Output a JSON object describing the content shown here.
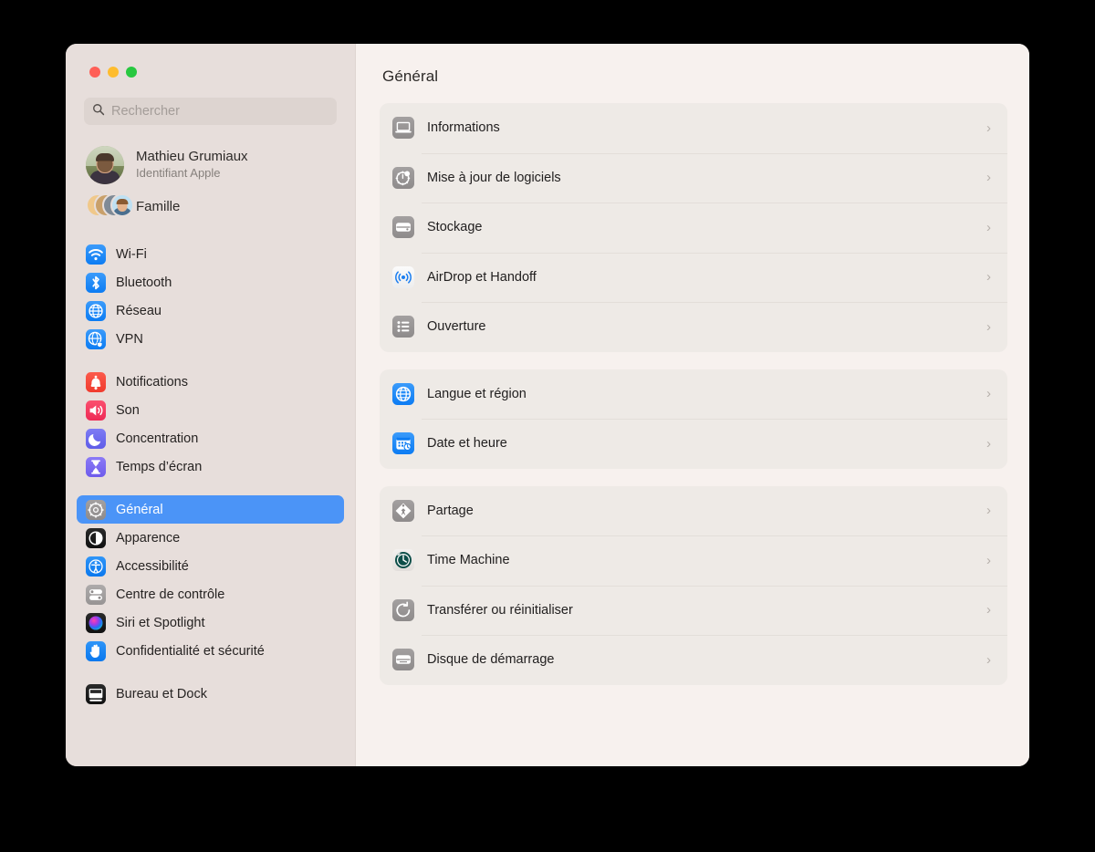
{
  "window": {
    "traffic_lights": [
      {
        "name": "close",
        "color": "#ff5f57"
      },
      {
        "name": "minimize",
        "color": "#febc2e"
      },
      {
        "name": "maximize",
        "color": "#28c840"
      }
    ]
  },
  "search": {
    "placeholder": "Rechercher",
    "value": "",
    "icon": "search-icon"
  },
  "account": {
    "name": "Mathieu Grumiaux",
    "subtitle": "Identifiant Apple",
    "family_label": "Famille"
  },
  "sidebar": {
    "groups": [
      {
        "items": [
          {
            "label": "Wi-Fi",
            "icon": "wifi-icon",
            "color": "#0c7cf3",
            "selected": false
          },
          {
            "label": "Bluetooth",
            "icon": "bluetooth-icon",
            "color": "#0c7cf3",
            "selected": false
          },
          {
            "label": "Réseau",
            "icon": "globe-icon",
            "color": "#0c7cf3",
            "selected": false
          },
          {
            "label": "VPN",
            "icon": "vpn-globe-icon",
            "color": "#0c7cf3",
            "selected": false
          }
        ]
      },
      {
        "items": [
          {
            "label": "Notifications",
            "icon": "bell-icon",
            "color": "#f03b2e",
            "selected": false
          },
          {
            "label": "Son",
            "icon": "speaker-icon",
            "color": "#ee2a56",
            "selected": false
          },
          {
            "label": "Concentration",
            "icon": "moon-icon",
            "color": "#5f5de8",
            "selected": false
          },
          {
            "label": "Temps d’écran",
            "icon": "hourglass-icon",
            "color": "#6e5bec",
            "selected": false
          }
        ]
      },
      {
        "items": [
          {
            "label": "Général",
            "icon": "gear-icon",
            "color": "#8e8b8b",
            "selected": true
          },
          {
            "label": "Apparence",
            "icon": "appearance-icon",
            "color": "#101010",
            "selected": false
          },
          {
            "label": "Accessibilité",
            "icon": "accessibility-icon",
            "color": "#0c7cf3",
            "selected": false
          },
          {
            "label": "Centre de contrôle",
            "icon": "control-center-icon",
            "color": "#8e8b8b",
            "selected": false
          },
          {
            "label": "Siri et Spotlight",
            "icon": "siri-icon",
            "color": "#9b37e8",
            "selected": false
          },
          {
            "label": "Confidentialité et sécurité",
            "icon": "hand-icon",
            "color": "#0c7cf3",
            "selected": false
          }
        ]
      },
      {
        "items": [
          {
            "label": "Bureau et Dock",
            "icon": "desktop-dock-icon",
            "color": "#2a2a2a",
            "selected": false
          }
        ]
      }
    ]
  },
  "main": {
    "title": "Général",
    "cards": [
      {
        "rows": [
          {
            "label": "Informations",
            "icon": "laptop-icon",
            "style": "gray",
            "chevron": "›"
          },
          {
            "label": "Mise à jour de logiciels",
            "icon": "software-update-icon",
            "style": "gray",
            "chevron": "›"
          },
          {
            "label": "Stockage",
            "icon": "storage-icon",
            "style": "gray",
            "chevron": "›"
          },
          {
            "label": "AirDrop et Handoff",
            "icon": "airdrop-icon",
            "style": "white",
            "chevron": "›"
          },
          {
            "label": "Ouverture",
            "icon": "login-items-icon",
            "style": "gray",
            "chevron": "›"
          }
        ]
      },
      {
        "rows": [
          {
            "label": "Langue et région",
            "icon": "language-globe-icon",
            "style": "blue",
            "chevron": "›"
          },
          {
            "label": "Date et heure",
            "icon": "date-time-icon",
            "style": "blue",
            "chevron": "›"
          }
        ]
      },
      {
        "rows": [
          {
            "label": "Partage",
            "icon": "sharing-icon",
            "style": "gray",
            "chevron": "›"
          },
          {
            "label": "Time Machine",
            "icon": "time-machine-icon",
            "style": "teal",
            "chevron": "›"
          },
          {
            "label": "Transférer ou réinitialiser",
            "icon": "transfer-reset-icon",
            "style": "gray",
            "chevron": "›"
          },
          {
            "label": "Disque de démarrage",
            "icon": "startup-disk-icon",
            "style": "gray",
            "chevron": "›"
          }
        ]
      }
    ]
  }
}
